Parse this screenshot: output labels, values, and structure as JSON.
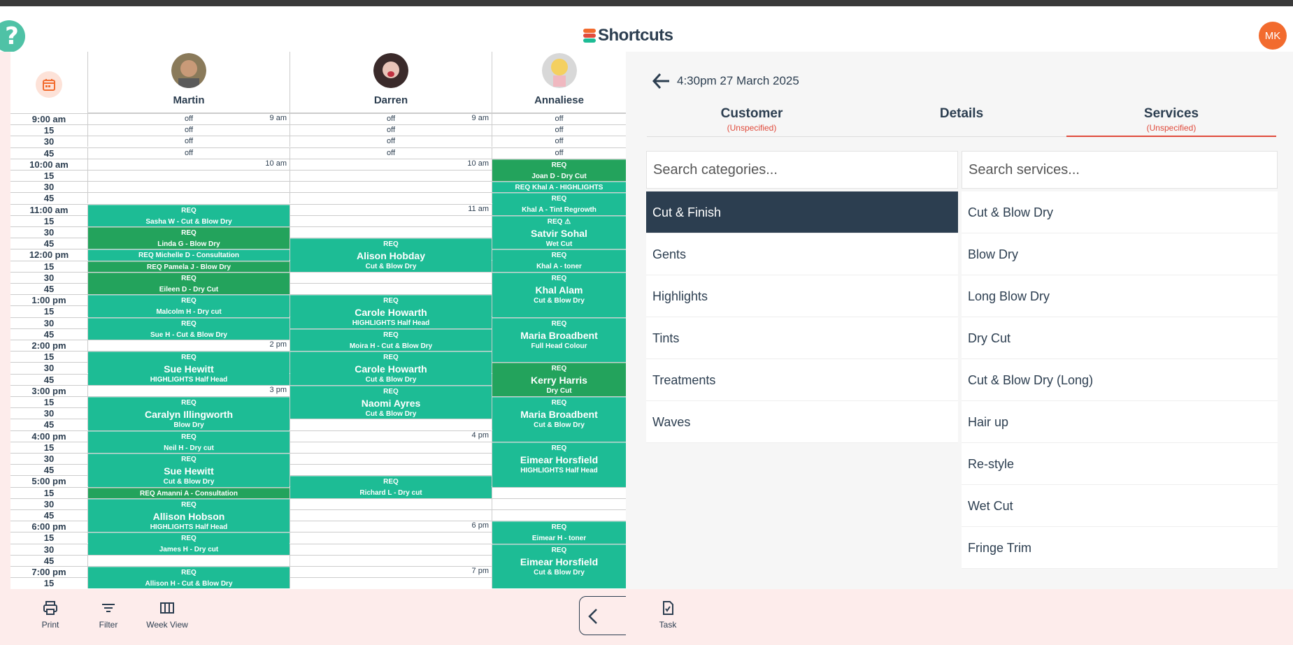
{
  "app": {
    "title": "Shortcuts",
    "user_initials": "MK",
    "help_label": "?"
  },
  "colors": {
    "teal": "#1dbc95",
    "teal_dark": "#23a35c",
    "accent": "#e04b3c",
    "navy": "#2c3e50",
    "brand_orange": "#f26b2e"
  },
  "calendar": {
    "staff": [
      {
        "name": "Martin"
      },
      {
        "name": "Darren"
      },
      {
        "name": "Annaliese"
      }
    ],
    "time_labels": [
      "9:00 am",
      "15",
      "30",
      "45",
      "10:00 am",
      "15",
      "30",
      "45",
      "11:00 am",
      "15",
      "30",
      "45",
      "12:00 pm",
      "15",
      "30",
      "45",
      "1:00 pm",
      "15",
      "30",
      "45",
      "2:00 pm",
      "15",
      "30",
      "45",
      "3:00 pm",
      "15",
      "30",
      "45",
      "4:00 pm",
      "15",
      "30",
      "45",
      "5:00 pm",
      "15",
      "30",
      "45",
      "6:00 pm",
      "15",
      "30",
      "45",
      "7:00 pm",
      "15"
    ],
    "off_label": "off",
    "hour_marks": {
      "martin": [
        {
          "row": 0,
          "text": "9 am"
        },
        {
          "row": 4,
          "text": "10 am"
        },
        {
          "row": 20,
          "text": "2 pm"
        },
        {
          "row": 24,
          "text": "3 pm"
        }
      ],
      "darren": [
        {
          "row": 0,
          "text": "9 am"
        },
        {
          "row": 4,
          "text": "10 am"
        },
        {
          "row": 8,
          "text": "11 am"
        },
        {
          "row": 28,
          "text": "4 pm"
        },
        {
          "row": 36,
          "text": "6 pm"
        },
        {
          "row": 40,
          "text": "7 pm"
        }
      ]
    },
    "appointments": [
      {
        "col": 0,
        "start": 8,
        "rows": 2,
        "dark": false,
        "lines": [
          "REQ",
          "Sasha W - Cut & Blow Dry"
        ]
      },
      {
        "col": 0,
        "start": 10,
        "rows": 2,
        "dark": true,
        "lines": [
          "REQ",
          "Linda G - Blow Dry"
        ]
      },
      {
        "col": 0,
        "start": 12,
        "rows": 1,
        "dark": false,
        "lines": [
          "REQ  Michelle D - Consultation"
        ]
      },
      {
        "col": 0,
        "start": 13,
        "rows": 1,
        "dark": true,
        "lines": [
          "REQ  Pamela J - Blow Dry"
        ]
      },
      {
        "col": 0,
        "start": 14,
        "rows": 2,
        "dark": true,
        "lines": [
          "REQ",
          "Eileen D - Dry Cut"
        ]
      },
      {
        "col": 0,
        "start": 16,
        "rows": 2,
        "dark": false,
        "lines": [
          "REQ",
          "Malcolm H - Dry cut"
        ]
      },
      {
        "col": 0,
        "start": 18,
        "rows": 2,
        "dark": false,
        "lines": [
          "REQ",
          "Sue H - Cut & Blow Dry"
        ]
      },
      {
        "col": 0,
        "start": 21,
        "rows": 3,
        "dark": false,
        "big": "Sue Hewitt",
        "lines": [
          "REQ",
          "HIGHLIGHTS Half Head"
        ]
      },
      {
        "col": 0,
        "start": 25,
        "rows": 3,
        "dark": false,
        "big": "Caralyn Illingworth",
        "lines": [
          "REQ",
          "Blow Dry"
        ]
      },
      {
        "col": 0,
        "start": 28,
        "rows": 2,
        "dark": false,
        "lines": [
          "REQ",
          "Neil H - Dry cut"
        ]
      },
      {
        "col": 0,
        "start": 30,
        "rows": 3,
        "dark": false,
        "big": "Sue Hewitt",
        "lines": [
          "REQ",
          "Cut & Blow Dry"
        ]
      },
      {
        "col": 0,
        "start": 33,
        "rows": 1,
        "dark": true,
        "lines": [
          "REQ  Amanni A - Consultation"
        ]
      },
      {
        "col": 0,
        "start": 34,
        "rows": 3,
        "dark": false,
        "big": "Allison Hobson",
        "lines": [
          "REQ",
          "HIGHLIGHTS Half Head"
        ]
      },
      {
        "col": 0,
        "start": 37,
        "rows": 2,
        "dark": false,
        "lines": [
          "REQ",
          "James H - Dry cut"
        ]
      },
      {
        "col": 0,
        "start": 40,
        "rows": 2,
        "dark": false,
        "lines": [
          "REQ",
          "Allison H - Cut & Blow Dry"
        ]
      },
      {
        "col": 1,
        "start": 11,
        "rows": 3,
        "dark": false,
        "big": "Alison Hobday",
        "lines": [
          "REQ",
          "Cut & Blow Dry"
        ]
      },
      {
        "col": 1,
        "start": 16,
        "rows": 3,
        "dark": false,
        "big": "Carole Howarth",
        "lines": [
          "REQ",
          "HIGHLIGHTS Half Head"
        ]
      },
      {
        "col": 1,
        "start": 19,
        "rows": 2,
        "dark": false,
        "lines": [
          "REQ",
          "Moira H - Cut & Blow Dry"
        ]
      },
      {
        "col": 1,
        "start": 21,
        "rows": 3,
        "dark": false,
        "big": "Carole Howarth",
        "lines": [
          "REQ",
          "Cut & Blow Dry"
        ]
      },
      {
        "col": 1,
        "start": 24,
        "rows": 3,
        "dark": false,
        "big": "Naomi Ayres",
        "lines": [
          "REQ",
          "Cut & Blow Dry"
        ]
      },
      {
        "col": 1,
        "start": 32,
        "rows": 2,
        "dark": false,
        "lines": [
          "REQ",
          "Richard L - Dry cut"
        ]
      },
      {
        "col": 2,
        "start": 4,
        "rows": 2,
        "dark": true,
        "lines": [
          "REQ",
          "Joan D - Dry Cut"
        ]
      },
      {
        "col": 2,
        "start": 6,
        "rows": 1,
        "dark": false,
        "lines": [
          "REQ  Khal A - HIGHLIGHTS"
        ]
      },
      {
        "col": 2,
        "start": 7,
        "rows": 2,
        "dark": false,
        "lines": [
          "REQ",
          "Khal A - Tint Regrowth"
        ]
      },
      {
        "col": 2,
        "start": 9,
        "rows": 3,
        "dark": false,
        "big": "Satvir Sohal",
        "lines": [
          "REQ ⚠",
          "Wet Cut"
        ]
      },
      {
        "col": 2,
        "start": 12,
        "rows": 2,
        "dark": false,
        "lines": [
          "REQ",
          "Khal A - toner"
        ]
      },
      {
        "col": 2,
        "start": 14,
        "rows": 4,
        "dark": false,
        "big": "Khal Alam",
        "lines": [
          "REQ",
          "Cut & Blow Dry"
        ]
      },
      {
        "col": 2,
        "start": 18,
        "rows": 4,
        "dark": false,
        "big": "Maria Broadbent",
        "lines": [
          "REQ",
          "Full Head Colour"
        ]
      },
      {
        "col": 2,
        "start": 22,
        "rows": 3,
        "dark": true,
        "big": "Kerry Harris",
        "lines": [
          "REQ",
          "Dry Cut"
        ]
      },
      {
        "col": 2,
        "start": 25,
        "rows": 4,
        "dark": false,
        "big": "Maria Broadbent",
        "lines": [
          "REQ",
          "Cut & Blow Dry"
        ]
      },
      {
        "col": 2,
        "start": 29,
        "rows": 4,
        "dark": false,
        "big": "Eimear Horsfield",
        "lines": [
          "REQ",
          "HIGHLIGHTS Half Head"
        ]
      },
      {
        "col": 2,
        "start": 36,
        "rows": 2,
        "dark": false,
        "lines": [
          "REQ",
          "Eimear H - toner"
        ]
      },
      {
        "col": 2,
        "start": 38,
        "rows": 4,
        "dark": false,
        "big": "Eimear Horsfield",
        "lines": [
          "REQ",
          "Cut & Blow Dry"
        ]
      }
    ]
  },
  "panel": {
    "datetime": "4:30pm 27 March 2025",
    "tabs": [
      {
        "label": "Customer",
        "sub": "(Unspecified)"
      },
      {
        "label": "Details",
        "sub": ""
      },
      {
        "label": "Services",
        "sub": "(Unspecified)"
      }
    ],
    "category_placeholder": "Search categories...",
    "service_placeholder": "Search services...",
    "categories": [
      "Cut & Finish",
      "Gents",
      "Highlights",
      "Tints",
      "Treatments",
      "Waves"
    ],
    "selected_category": "Cut & Finish",
    "services": [
      "Cut & Blow Dry",
      "Blow Dry",
      "Long Blow Dry",
      "Dry Cut",
      "Cut & Blow Dry (Long)",
      "Hair up",
      "Re-style",
      "Wet Cut",
      "Fringe Trim"
    ]
  },
  "toolbar": {
    "print": "Print",
    "filter": "Filter",
    "week_view": "Week View",
    "task": "Task"
  }
}
